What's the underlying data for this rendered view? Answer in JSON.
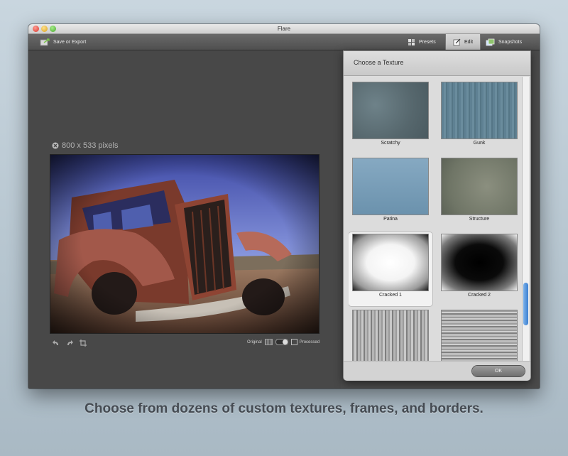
{
  "window": {
    "title": "Flare"
  },
  "toolbar": {
    "save_label": "Save or Export",
    "presets_label": "Presets",
    "edit_label": "Edit",
    "snapshots_label": "Snapshots"
  },
  "canvas": {
    "image_size": "800 x 533 pixels",
    "original_label": "Original",
    "processed_label": "Processed"
  },
  "panel": {
    "title": "Choose a Texture",
    "ok_label": "OK",
    "selected": "Cracked 1",
    "textures": [
      {
        "label": "Scratchy"
      },
      {
        "label": "Gunk"
      },
      {
        "label": "Patina"
      },
      {
        "label": "Structure"
      },
      {
        "label": "Cracked 1"
      },
      {
        "label": "Cracked 2"
      },
      {
        "label": ""
      },
      {
        "label": ""
      }
    ]
  },
  "caption": "Choose from dozens of custom textures, frames, and borders.",
  "icons": {
    "save": "save-export-icon",
    "presets": "presets-icon",
    "edit": "edit-icon",
    "snapshots": "snapshots-icon",
    "undo": "undo-icon",
    "redo": "redo-icon",
    "crop": "crop-icon",
    "close_image": "close-circle-icon"
  },
  "colors": {
    "window_bg": "#4a4a4a",
    "panel_bg": "#dcdcdc",
    "scroll_accent": "#3c7fd0"
  }
}
